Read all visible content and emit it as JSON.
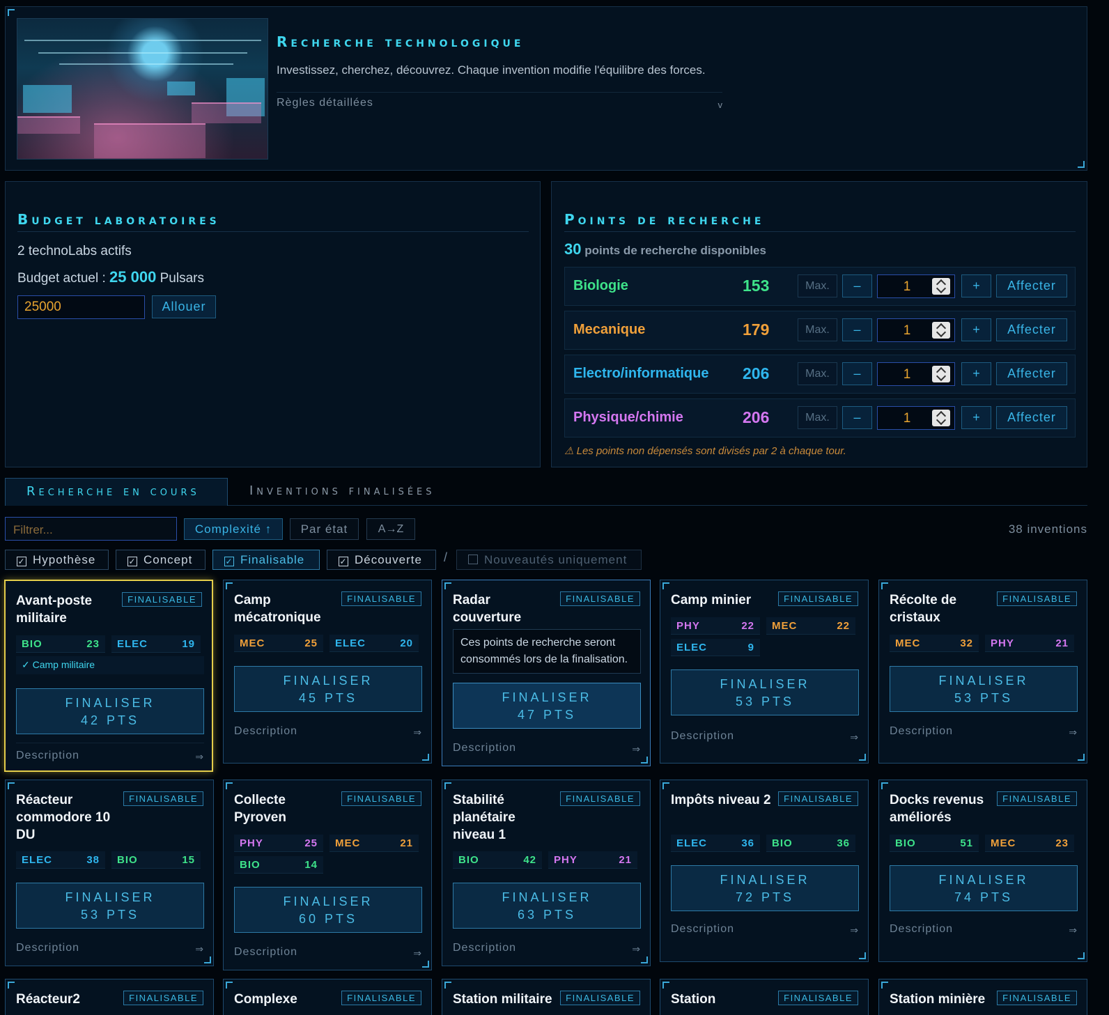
{
  "header": {
    "title": "Recherche technologique",
    "subtitle": "Investissez, cherchez, découvrez. Chaque invention modifie l'équilibre des forces.",
    "rules_link": "Règles détaillées",
    "rules_chevron": "v"
  },
  "budget": {
    "title": "Budget laboratoires",
    "labs": "2 technoLabs actifs",
    "current_prefix": "Budget actuel : ",
    "current_value": "25 000",
    "currency": "Pulsars",
    "input_value": "25000",
    "allocate_label": "Allouer"
  },
  "points": {
    "title": "Points de recherche",
    "available_value": "30",
    "available_label": "points de recherche disponibles",
    "max_label": "Max.",
    "minus_label": "–",
    "plus_label": "+",
    "assign_label": "Affecter",
    "skills": [
      {
        "name": "Biologie",
        "value": "153",
        "qty": "1",
        "color": "#3ee38a"
      },
      {
        "name": "Mecanique",
        "value": "179",
        "qty": "1",
        "color": "#f0a03a"
      },
      {
        "name": "Electro/informatique",
        "value": "206",
        "qty": "1",
        "color": "#2fb6ee"
      },
      {
        "name": "Physique/chimie",
        "value": "206",
        "qty": "1",
        "color": "#d477f0"
      }
    ],
    "warning": "⚠ Les points non dépensés sont divisés par 2 à chaque tour."
  },
  "tabs": [
    {
      "label": "Recherche en cours",
      "active": true
    },
    {
      "label": "Inventions finalisées",
      "active": false
    }
  ],
  "filters": {
    "search_placeholder": "Filtrer...",
    "sort_complexity": "Complexité ↑",
    "sort_state": "Par état",
    "sort_alpha": "A→Z",
    "count": "38 inventions",
    "checks": [
      {
        "label": "Hypothèse",
        "checked": true
      },
      {
        "label": "Concept",
        "checked": true
      },
      {
        "label": "Finalisable",
        "checked": true
      },
      {
        "label": "Découverte",
        "checked": true
      }
    ],
    "separator": "/",
    "news_only": "Nouveautés uniquement"
  },
  "card_common": {
    "badge": "FINALISABLE",
    "finalize": "FINALISER",
    "description": "Description",
    "arrow": "⇒"
  },
  "cards": [
    {
      "title": "Avant-poste militaire",
      "stats": [
        {
          "k": "BIO",
          "v": "23"
        },
        {
          "k": "ELEC",
          "v": "19"
        }
      ],
      "note": "✓ Camp militaire",
      "pts": "42 PTS"
    },
    {
      "title": "Camp mécatronique",
      "stats": [
        {
          "k": "MEC",
          "v": "25"
        },
        {
          "k": "ELEC",
          "v": "20"
        }
      ],
      "pts": "45 PTS"
    },
    {
      "title": "Radar couverture",
      "tooltip": "Ces points de recherche seront consommés lors de la finalisation.",
      "pts": "47 PTS"
    },
    {
      "title": "Camp minier",
      "stats": [
        {
          "k": "PHY",
          "v": "22"
        },
        {
          "k": "MEC",
          "v": "22"
        },
        {
          "k": "ELEC",
          "v": "9"
        }
      ],
      "pts": "53 PTS"
    },
    {
      "title": "Récolte de cristaux",
      "stats": [
        {
          "k": "MEC",
          "v": "32"
        },
        {
          "k": "PHY",
          "v": "21"
        }
      ],
      "pts": "53 PTS"
    },
    {
      "title": "Réacteur commodore 10 DU",
      "stats": [
        {
          "k": "ELEC",
          "v": "38"
        },
        {
          "k": "BIO",
          "v": "15"
        }
      ],
      "pts": "53 PTS"
    },
    {
      "title": "Collecte Pyroven",
      "stats": [
        {
          "k": "PHY",
          "v": "25"
        },
        {
          "k": "MEC",
          "v": "21"
        },
        {
          "k": "BIO",
          "v": "14"
        }
      ],
      "pts": "60 PTS"
    },
    {
      "title": "Stabilité planétaire niveau 1",
      "stats": [
        {
          "k": "BIO",
          "v": "42"
        },
        {
          "k": "PHY",
          "v": "21"
        }
      ],
      "pts": "63 PTS"
    },
    {
      "title": "Impôts niveau 2",
      "stats": [
        {
          "k": "ELEC",
          "v": "36"
        },
        {
          "k": "BIO",
          "v": "36"
        }
      ],
      "pts": "72 PTS"
    },
    {
      "title": "Docks revenus améliorés",
      "stats": [
        {
          "k": "BIO",
          "v": "51"
        },
        {
          "k": "MEC",
          "v": "23"
        }
      ],
      "pts": "74 PTS"
    },
    {
      "title": "Réacteur2"
    },
    {
      "title": "Complexe"
    },
    {
      "title": "Station militaire"
    },
    {
      "title": "Station"
    },
    {
      "title": "Station minière"
    }
  ]
}
